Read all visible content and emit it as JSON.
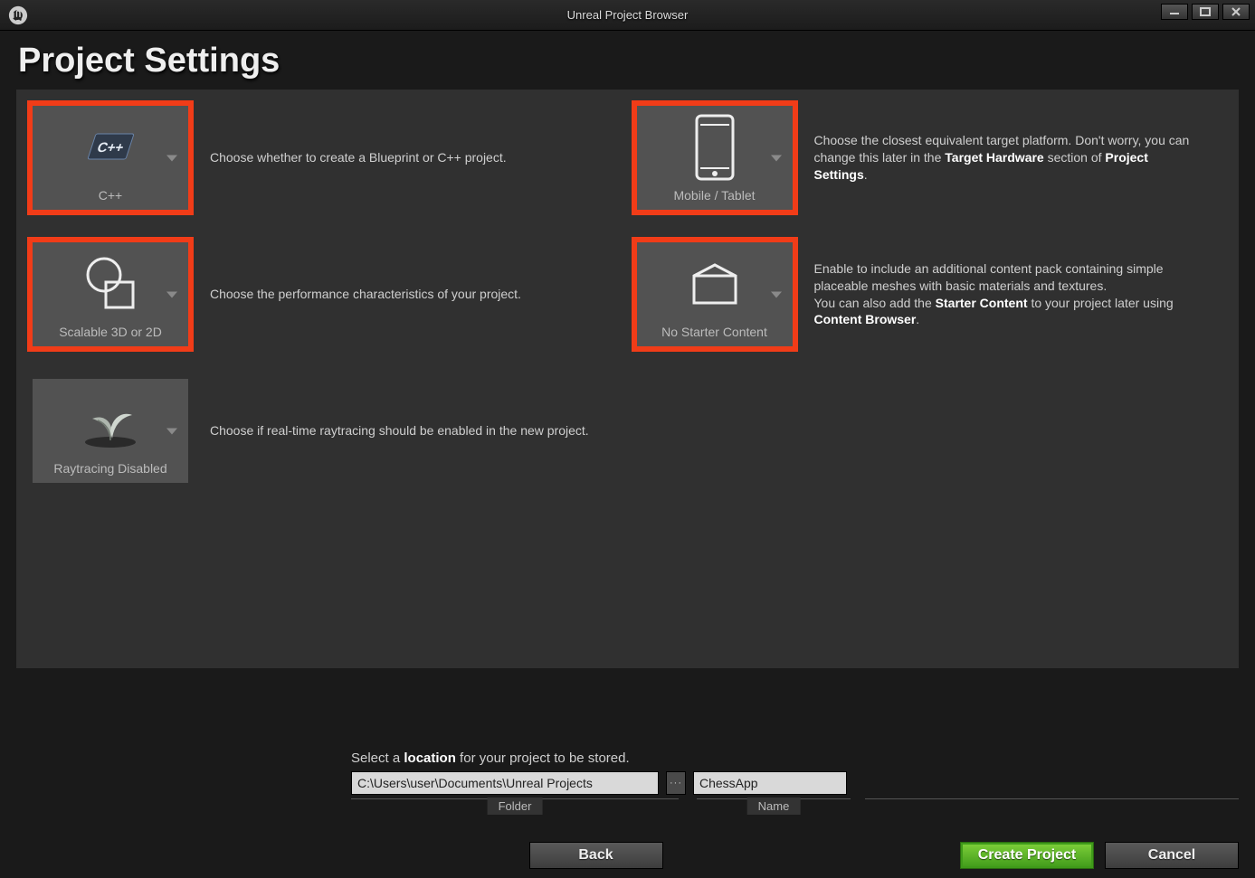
{
  "window": {
    "title": "Unreal Project Browser"
  },
  "header": {
    "title": "Project Settings"
  },
  "options": {
    "codeType": {
      "label": "C++",
      "desc_plain": "Choose whether to create a Blueprint or C++ project."
    },
    "platform": {
      "label": "Mobile / Tablet",
      "desc_pre": "Choose the closest equivalent target platform. Don't worry, you can change this later in the ",
      "bold1": "Target Hardware",
      "mid": " section of ",
      "bold2": "Project Settings",
      "post": "."
    },
    "quality": {
      "label": "Scalable 3D or 2D",
      "desc_plain": "Choose the performance characteristics of your project."
    },
    "starter": {
      "label": "No Starter Content",
      "desc_pre": "Enable to include an additional content pack containing simple placeable meshes with basic materials and textures.\nYou can also add the ",
      "bold1": "Starter Content",
      "mid": " to your project later using ",
      "bold2": "Content Browser",
      "post": "."
    },
    "raytracing": {
      "label": "Raytracing Disabled",
      "desc_plain": "Choose if real-time raytracing should be enabled in the new project."
    }
  },
  "location": {
    "prompt_pre": "Select a ",
    "prompt_bold": "location",
    "prompt_post": " for your project to be stored.",
    "folder_value": "C:\\Users\\user\\Documents\\Unreal Projects",
    "name_value": "ChessApp",
    "folder_label": "Folder",
    "name_label": "Name"
  },
  "buttons": {
    "back": "Back",
    "create": "Create Project",
    "cancel": "Cancel"
  }
}
